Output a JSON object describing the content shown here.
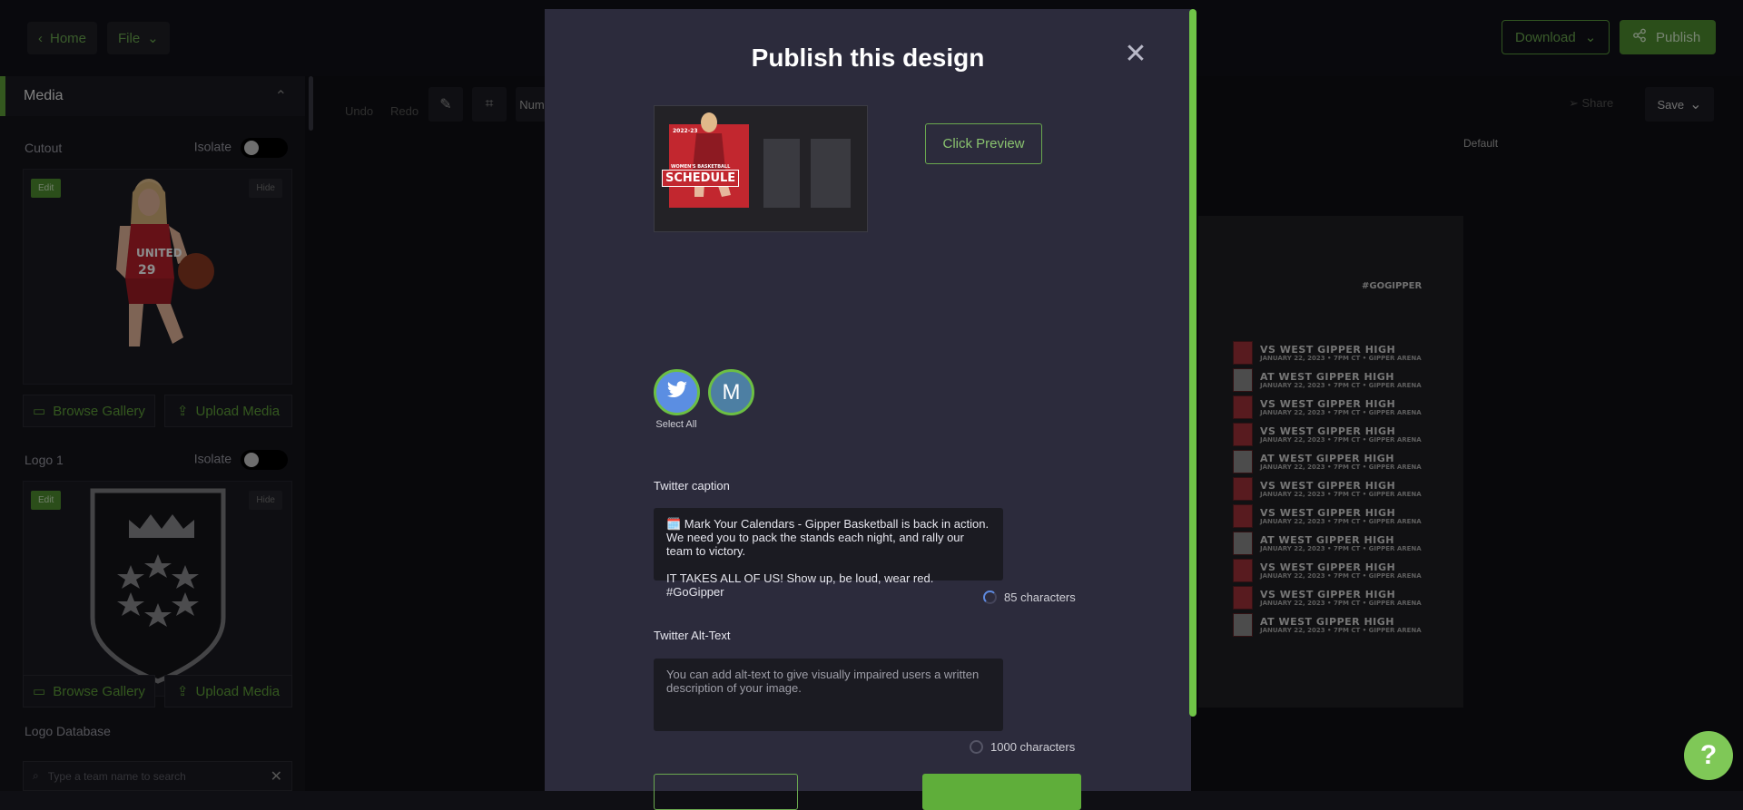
{
  "topbar": {
    "home_label": "Home",
    "file_label": "File",
    "download_label": "Download",
    "publish_label": "Publish"
  },
  "sidebar": {
    "section_title": "Media",
    "cutout_label": "Cutout",
    "isolate_label": "Isolate",
    "edit_label": "Edit",
    "hide_label": "Hide",
    "browse_gallery_label": "Browse Gallery",
    "upload_media_label": "Upload Media",
    "logo1_label": "Logo 1",
    "logo_database_label": "Logo Database",
    "search_placeholder": "Type a team name to search"
  },
  "toolbar": {
    "undo_label": "Undo",
    "redo_label": "Redo",
    "num_label": "Num",
    "share_label": "Share",
    "save_label": "Save",
    "default_label": "Default"
  },
  "preview": {
    "hashtag": "#GOGIPPER",
    "rows": [
      {
        "title": "VS WEST GIPPER HIGH",
        "sub": "JANUARY 22, 2023 • 7PM CT • GIPPER ARENA",
        "home": true
      },
      {
        "title": "AT WEST GIPPER HIGH",
        "sub": "JANUARY 22, 2023 • 7PM CT • GIPPER ARENA",
        "home": false
      },
      {
        "title": "VS WEST GIPPER HIGH",
        "sub": "JANUARY 22, 2023 • 7PM CT • GIPPER ARENA",
        "home": true
      },
      {
        "title": "VS WEST GIPPER HIGH",
        "sub": "JANUARY 22, 2023 • 7PM CT • GIPPER ARENA",
        "home": true
      },
      {
        "title": "AT WEST GIPPER HIGH",
        "sub": "JANUARY 22, 2023 • 7PM CT • GIPPER ARENA",
        "home": false
      },
      {
        "title": "VS WEST GIPPER HIGH",
        "sub": "JANUARY 22, 2023 • 7PM CT • GIPPER ARENA",
        "home": true
      },
      {
        "title": "VS WEST GIPPER HIGH",
        "sub": "JANUARY 22, 2023 • 7PM CT • GIPPER ARENA",
        "home": true
      },
      {
        "title": "AT WEST GIPPER HIGH",
        "sub": "JANUARY 22, 2023 • 7PM CT • GIPPER ARENA",
        "home": false
      },
      {
        "title": "VS WEST GIPPER HIGH",
        "sub": "JANUARY 22, 2023 • 7PM CT • GIPPER ARENA",
        "home": true
      },
      {
        "title": "VS WEST GIPPER HIGH",
        "sub": "JANUARY 22, 2023 • 7PM CT • GIPPER ARENA",
        "home": true
      },
      {
        "title": "AT WEST GIPPER HIGH",
        "sub": "JANUARY 22, 2023 • 7PM CT • GIPPER ARENA",
        "home": false
      }
    ]
  },
  "modal": {
    "title": "Publish this design",
    "close_symbol": "✕",
    "click_preview_label": "Click Preview",
    "thumb_title": "SCHEDULE",
    "thumb_subtitle": "WOMEN'S BASKETBALL",
    "thumb_season": "2022-23",
    "accounts": [
      {
        "icon": "twitter-icon"
      },
      {
        "initial": "M"
      }
    ],
    "select_all_label": "Select All",
    "twitter_caption_label": "Twitter caption",
    "twitter_caption_line1": "🗓️ Mark Your Calendars - Gipper Basketball is back in action. We need you to pack the stands each night, and rally our team to victory.",
    "twitter_caption_line2": "IT TAKES ALL OF US! Show up, be loud, wear red. #GoGipper",
    "caption_count": "85 characters",
    "alt_text_label": "Twitter Alt-Text",
    "alt_text_placeholder": "You can add alt-text to give visually impaired users a written description of your image.",
    "alt_count": "1000 characters"
  },
  "help_symbol": "?",
  "colors": {
    "accent": "#5fa03a",
    "modal_bg": "#2c2b3c",
    "scroll_accent": "#6fc447"
  }
}
